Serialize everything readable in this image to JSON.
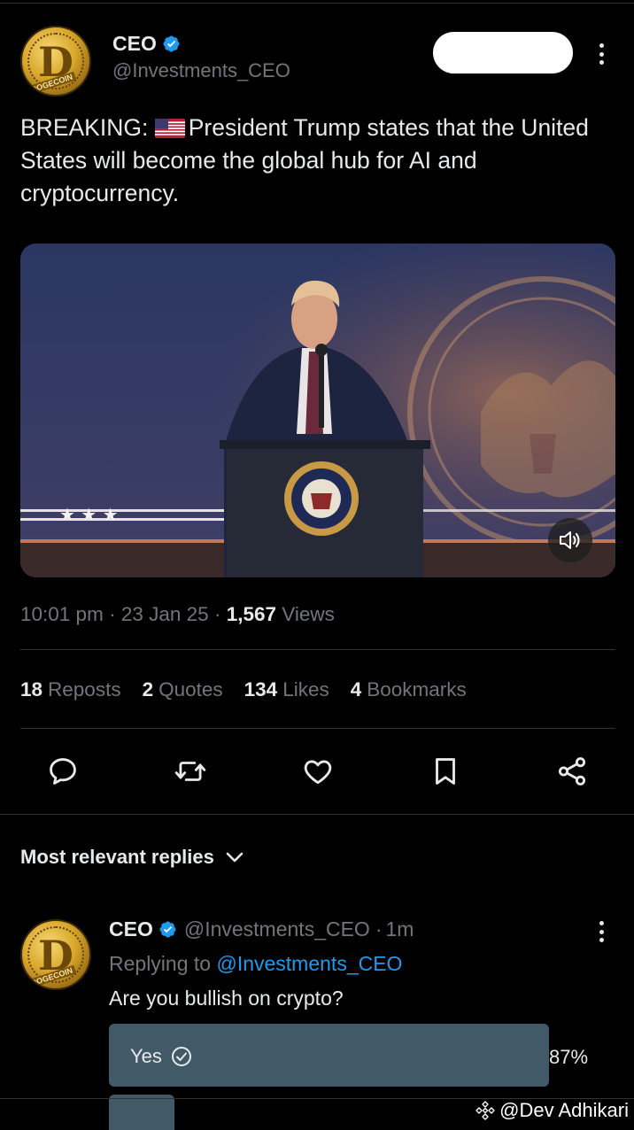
{
  "post": {
    "author_name": "CEO",
    "author_handle": "@Investments_CEO",
    "avatar_text": "D",
    "avatar_coin_text": "DOGECOIN",
    "text": "BREAKING: 🇺🇸 President Trump states that the United States will become the global hub for AI and cryptocurrency.",
    "text_before_flag": "BREAKING:",
    "text_after_flag": "President Trump states that the United States will become the global hub for AI and cryptocurrency.",
    "time": "10:01 pm",
    "date": "23 Jan 25",
    "views_count": "1,567",
    "views_label": "Views",
    "seal_text": "SEAL OF THE PRESIDENT OF THE UNITED STATES"
  },
  "stats": [
    {
      "count": "18",
      "label": "Reposts"
    },
    {
      "count": "2",
      "label": "Quotes"
    },
    {
      "count": "134",
      "label": "Likes"
    },
    {
      "count": "4",
      "label": "Bookmarks"
    }
  ],
  "actions": [
    "reply-icon",
    "repost-icon",
    "like-icon",
    "bookmark-icon",
    "share-icon"
  ],
  "replies_sort_label": "Most relevant replies",
  "reply": {
    "author_name": "CEO",
    "author_handle": "@Investments_CEO",
    "time_ago": "1m",
    "replying_prefix": "Replying to",
    "replying_to": "@Investments_CEO",
    "text": "Are you bullish on crypto?",
    "poll": [
      {
        "label": "Yes",
        "percent": "87%",
        "fraction": 0.87,
        "selected": true
      }
    ]
  },
  "watermark": "@Dev Adhikari",
  "colors": {
    "background": "#000000",
    "text_primary": "#e7e9ea",
    "text_secondary": "#71767b",
    "link": "#1d9bf0",
    "verified": "#1d9bf0",
    "poll_bar": "#425968",
    "divider": "#2f3336"
  }
}
